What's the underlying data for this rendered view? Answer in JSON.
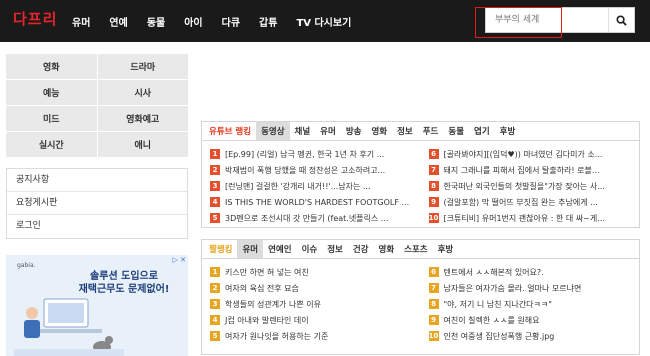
{
  "header": {
    "logo": "다프리",
    "nav": [
      "유머",
      "연예",
      "동물",
      "아이",
      "다큐",
      "갑튜",
      "TV 다시보기"
    ],
    "search": {
      "placeholder": "부부의 세계",
      "icon": "search-icon"
    }
  },
  "categories": [
    "영화",
    "드라마",
    "예능",
    "시사",
    "미드",
    "영화예고",
    "실시간",
    "애니"
  ],
  "side_menu": [
    "공지사항",
    "요청게시판",
    "로그인"
  ],
  "ad": {
    "logo": "gabia.",
    "headline_line1": "솔루션 도입으로",
    "headline_line2": "재택근무도 문제없어!",
    "corner": "▷ ✕"
  },
  "youtube_ranking": {
    "title": "유튜브 랭킹",
    "tabs": [
      "동영상",
      "채널",
      "유머",
      "방송",
      "영화",
      "정보",
      "푸드",
      "동물",
      "엽기",
      "후방"
    ],
    "active_tab": "동영상",
    "left": [
      {
        "n": "1",
        "text": "[Ep.99] (리얼) 남극 펭귄, 한국 1년 차 후기 ..."
      },
      {
        "n": "2",
        "text": "박재범이 폭행 당했을 때 정찬성은 고소하려고..."
      },
      {
        "n": "3",
        "text": "[런닝맨] 걸걸한 '강개리 내거!!'...남자는 ..."
      },
      {
        "n": "4",
        "text": "IS THIS THE WORLD'S HARDEST FOOTGOLF ..."
      },
      {
        "n": "5",
        "text": "3D펜으로 조선시대 갓 만들기 (feat.넷플릭스 ..."
      }
    ],
    "right": [
      {
        "n": "6",
        "text": "[골라봐야지][(입덕♥)) 마녀였던 김다미가 소..."
      },
      {
        "n": "7",
        "text": "돼지 그래니를 피해서 집에서 탈출하라! 로블..."
      },
      {
        "n": "8",
        "text": "한국떠난 외국인들의 첫발질을\"가장 잦아는 사..."
      },
      {
        "n": "9",
        "text": "(걸알포함) 막 떨어뜨 부짓집 완는 추남에게 ..."
      },
      {
        "n": "10",
        "text": "[크튜티비] 유머1번지 괜찮아유 : 한 대 싸~게..."
      }
    ]
  },
  "pal_ranking": {
    "title": "짤랭킹",
    "tabs": [
      "유머",
      "연예인",
      "이슈",
      "정보",
      "건강",
      "영화",
      "스포츠",
      "후방"
    ],
    "active_tab": "유머",
    "left": [
      {
        "n": "1",
        "text": "키스만 하면 혀 넣는 여친"
      },
      {
        "n": "2",
        "text": "여자의 육심 전후 묘습"
      },
      {
        "n": "3",
        "text": "학생들의 성관계가 나쁜 이유"
      },
      {
        "n": "4",
        "text": "J컵 아내와 발렌타인 데이"
      },
      {
        "n": "5",
        "text": "여자가 원나잇을 허용하는 기준"
      }
    ],
    "right": [
      {
        "n": "6",
        "text": "텐트에서 ㅅㅅ해본적 있어요?."
      },
      {
        "n": "7",
        "text": "남자들은 여자가슴 몰라. 얼마나 모르냐면"
      },
      {
        "n": "8",
        "text": "\"야, 저기 니 남친 지나간다ㅋㅋ\""
      },
      {
        "n": "9",
        "text": "여친이 칠렉한 ㅅㅅ를 원해요"
      },
      {
        "n": "10",
        "text": "인천 여중생 집단성폭행 근황.jpg"
      }
    ]
  },
  "colors": {
    "header_bg": "#1a1a1a",
    "logo": "#e7252d",
    "rank_red": "#e5502c",
    "rank_yellow": "#e6a523",
    "highlight": "#e01b1b"
  }
}
